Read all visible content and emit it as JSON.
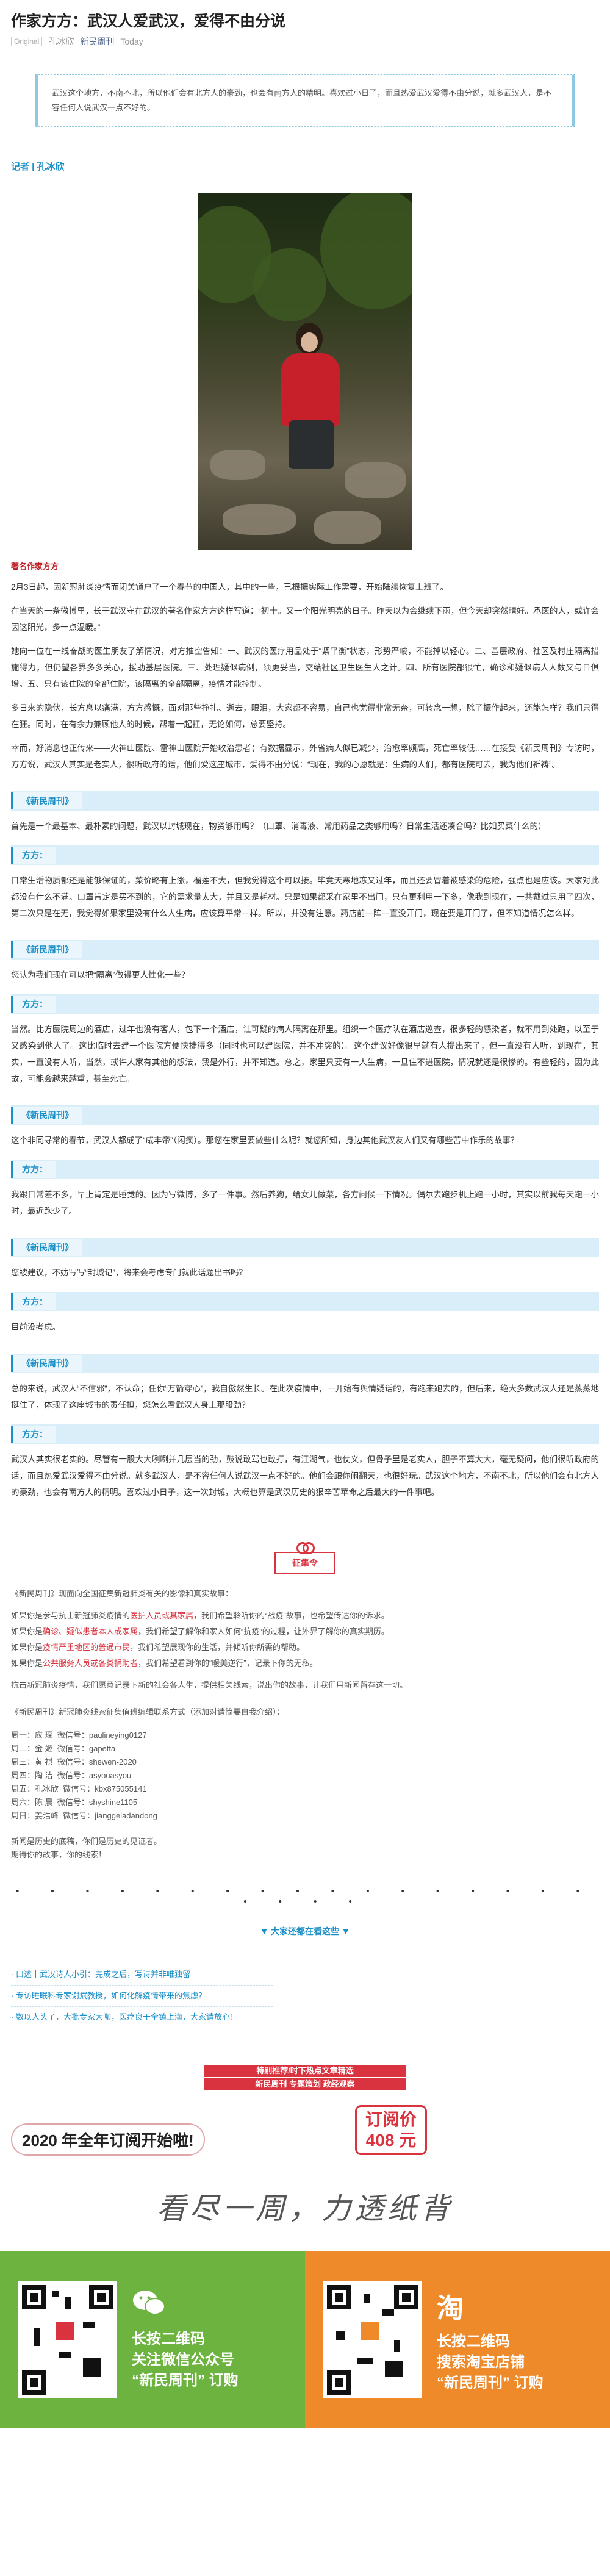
{
  "article": {
    "title": "作家方方：武汉人爱武汉，爱得不由分说",
    "original_tag": "Original",
    "author": "孔冰欣",
    "account": "新民周刊",
    "date": "Today"
  },
  "summary": "武汉这个地方，不南不北，所以他们会有北方人的豪劲，也会有南方人的精明。喜欢过小日子，而且热爱武汉爱得不由分说，就多武汉人，是不容任何人说武汉一点不好的。",
  "reporter": "记者 | 孔冰欣",
  "photo_caption": "著名作家方方",
  "intro_paragraphs": [
    "2月3日起，因新冠肺炎疫情而闭关锁户了一个春节的中国人，其中的一些，已根据实际工作需要，开始陆续恢复上班了。",
    "在当天的一条微博里，长于武汉守在武汉的著名作家方方这样写道：“初十。又一个阳光明亮的日子。昨天以为会继续下雨，但今天却突然晴好。承医的人，或许会因这阳光，多一点温暖。”",
    "她向一位在一线奋战的医生朋友了解情况，对方推空告知：一、武汉的医疗用品处于“紧平衡”状态，形势严峻，不能掉以轻心。二、基层政府、社区及村庄隔离措施得力，但仍望各界多多关心，援助基层医院。三、处理疑似病例，须更妥当，交给社区卫生医生人之计。四、所有医院都很忙，确诊和疑似病人人数又与日俱增。五、只有该住院的全部住院，该隔离的全部隔离，疫情才能控制。",
    "多日来的隐伏，长方息以痛满，方方感慨，面对那些挣扎、逝去，眼泪，大家都不容易，自己也觉得非常无奈，可转念一想，除了振作起来，还能怎样？我们只得在狂。同时，在有余力兼顾他人的时候，帮着一起扛，无论如何，总要坚持。",
    "幸而，好消息也正传来——火神山医院、雷神山医院开始收治患者；有数据显示，外省病人似已减少，治愈率颇高，死亡率较低……在接受《新民周刊》专访时，方方说，武汉人其实是老实人，很听政府的话，他们爱这座城市，爱得不由分说：“现在，我的心愿就是：生病的人们，都有医院可去，我为他们祈祷”。"
  ],
  "qa_label": "《新民周刊》",
  "answer_label": "方方：",
  "qa": [
    {
      "q": "首先是一个最基本、最朴素的问题，武汉以封城现在，物资够用吗？（口罩、消毒液、常用药品之类够用吗？日常生活还凑合吗？比如买菜什么的）",
      "a": "日常生活物质都还是能够保证的，菜价略有上涨，榴莲不大，但我觉得这个可以接。毕竟天寒地冻又过年，而且还要冒着被感染的危险，强点也是应该。大家对此都没有什么不满。口罩肯定是买不到的，它的需求量太大，并且又是耗材。只是如果都采在家里不出门，只有更利用一下多，像我到现在，一共戴过只用了四次，第二次只是在无，我觉得如果家里没有什么人生病，应该算平常一样。所以，并没有注意。药店前一阵一直没开门，现在要是开门了，但不知道情况怎么样。"
    },
    {
      "q": "您认为我们现在可以把“隔离”做得更人性化一些？",
      "a": "当然。比方医院周边的酒店，过年也没有客人，包下一个酒店，让可疑的病人隔离在那里。组织一个医疗队在酒店巡查，很多轻的感染者，就不用到处跑，以至于又感染到他人了。这比临时去建一个医院方便快捷得多（同时也可以建医院，并不冲突的）。这个建议好像很早就有人提出来了，但一直没有人听，到现在，其实，一直没有人听，当然，或许人家有其他的想法，我是外行，并不知道。总之，家里只要有一人生病，一旦住不进医院，情况就还是很惨的。有些轻的，因为此故，可能会越来越重，甚至死亡。"
    },
    {
      "q": "这个非同寻常的春节，武汉人都成了“咸丰帝”（闲疯）。那您在家里要做些什么呢？就您所知，身边其他武汉友人们又有哪些苦中作乐的故事？",
      "a": "我跟日常差不多，早上肯定是睡觉的。因为写微博，多了一件事。然后养狗，给女儿做菜，各方问候一下情况。偶尔去跑步机上跑一小时，其实以前我每天跑一小时，最近跑少了。"
    },
    {
      "q": "您被建议，不妨写写“封城记”，将来会考虑专门就此话题出书吗？",
      "a": "目前没考虑。"
    },
    {
      "q": "总的来说，武汉人“不信邪”，不认命；任你“万箭穿心”，我自傲然生长。在此次疫情中，一开始有舆情疑话的，有跑来跑去的，但后来，绝大多数武汉人还是蒸蒸地挺住了，体现了这座城市的责任担，您怎么看武汉人身上那股劲？",
      "a": "武汉人其实很老实的。尽管有一股大大咧咧并几层当的劲，鼓说敢骂也敢打，有江湖气，也仗义，但骨子里是老实人，胆子不算大大，毫无疑问，他们很听政府的话，而且热爱武汉爱得不由分说。就多武汉人，是不容任何人说武汉一点不好的。他们会跟你闹翻天，也很好玩。武汉这个地方，不南不北，所以他们会有北方人的豪劲，也会有南方人的精明。喜欢过小日子，这一次封城，大概也算是武汉历史的狠辛苦苹命之后最大的一件事吧。"
    }
  ],
  "badge_label": "征集令",
  "notice_intro": "《新民周刊》现面向全国征集新冠肺炎有关的影像和真实故事：",
  "notice_lines": [
    {
      "prefix": "如果你是参与抗击新冠肺炎疫情的",
      "red": "医护人员或其家属",
      "suffix": "，我们希望聆听你的“战疫”故事，也希望传达你的诉求。"
    },
    {
      "prefix": "如果你是",
      "red": "确诊、疑似患者本人或家属",
      "suffix": "，我们希望了解你和家人如何“抗疫”的过程，让外界了解你的真实期历。"
    },
    {
      "prefix": "如果你是",
      "red": "疫情严重地区的普通市民",
      "suffix": "，我们希望展现你的生活，并倾听你所需的帮助。"
    },
    {
      "prefix": "如果你是",
      "red": "公共服务人员或各类捐助者",
      "suffix": "，我们希望看到你的“暖美逆行”，记录下你的无私。"
    }
  ],
  "notice_more": "抗击新冠肺炎疫情，我们愿意记录下新的社会各人生，提供相关线索，说出你的故事，让我们用新闻留存这一切。",
  "contacts_intro": "《新民周刊》新冠肺炎线索征集值班编辑联系方式（添加对请简要自我介绍）：",
  "contacts": [
    {
      "name": "周一：应 琛",
      "wechat": "微信号：paulineying0127"
    },
    {
      "name": "周二：金 姬",
      "wechat": "微信号：gapetta"
    },
    {
      "name": "周三：黄 祺",
      "wechat": "微信号：shewen-2020"
    },
    {
      "name": "周四：陶 洁",
      "wechat": "微信号：asyouasyou"
    },
    {
      "name": "周五：孔冰欣",
      "wechat": "微信号：kbx875055141"
    },
    {
      "name": "周六：陈 晨",
      "wechat": "微信号：shyshine1105"
    },
    {
      "name": "周日：姜浩峰",
      "wechat": "微信号：jianggeladandong"
    }
  ],
  "closing": [
    "新闻是历史的底稿，你们是历史的见证者。",
    "期待你的故事，你的线索！"
  ],
  "dots": "• • • • • • • • • • • • • • • • • • • • •",
  "more_label": "▼ 大家还都在看这些 ▼",
  "related_links": [
    "· 口述丨武汉诗人小引：完成之后，写诗并非唯独留",
    "· 专访睡眠科专家谢斌教授，如何化解疫情带来的焦虑？",
    "· 数以人头了，大批专家大咖，医疗良于全镇上海，大家请放心！"
  ],
  "promo_red": [
    "特别推荐/时下热点文章精选",
    "新民周刊 专题策划 政经观察"
  ],
  "subscription": {
    "year": "2020 年全年订阅开始啦!",
    "price_label": "订阅价",
    "price": "408 元"
  },
  "slogan": "看尽一周，力透纸背",
  "qr_left": {
    "icon": "WeChat",
    "line1": "长按二维码",
    "line2": "关注微信公众号",
    "line3": "“新民周刊” 订购"
  },
  "qr_right": {
    "icon": "淘",
    "line1": "长按二维码",
    "line2": "搜索淘宝店铺",
    "line3": "“新民周刊” 订购"
  },
  "colors": {
    "accent_blue": "#1a8fc8",
    "accent_red": "#d9333f",
    "green_panel": "#6db33f",
    "orange_panel": "#ee8a2a"
  }
}
